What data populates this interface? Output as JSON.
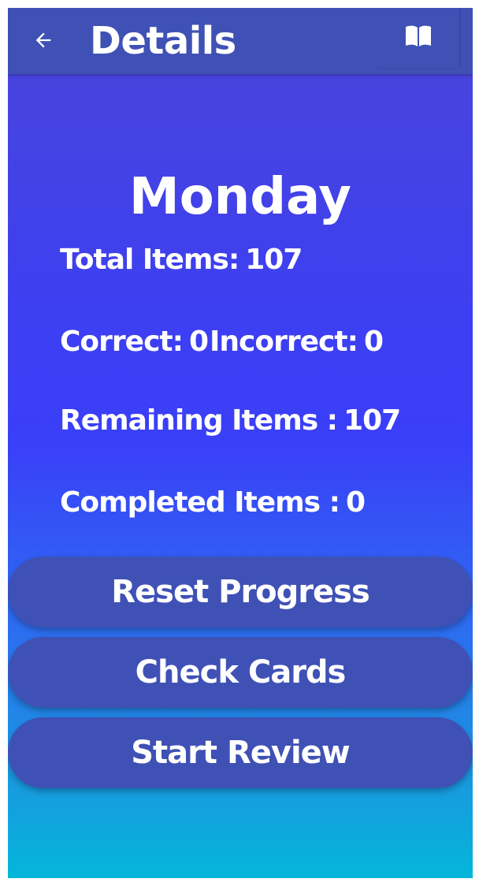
{
  "appbar": {
    "title": "Details",
    "back_icon": "arrow-back-icon",
    "action_icon": "open-book-icon"
  },
  "deck": {
    "name": "Monday"
  },
  "stats": {
    "total_label": "Total Items:",
    "total_value": "107",
    "correct_label": "Correct:",
    "correct_value": "0",
    "incorrect_label": "Incorrect:",
    "incorrect_value": "0",
    "remaining_label": "Remaining Items :",
    "remaining_value": "107",
    "completed_label": "Completed Items :",
    "completed_value": "0"
  },
  "actions": {
    "reset_label": "Reset Progress",
    "check_label": "Check Cards",
    "start_label": "Start Review"
  },
  "colors": {
    "appbar": "#3f51b5",
    "button": "#3f51b5",
    "gradient_top": "#4a46d8",
    "gradient_mid": "#3a3ff8",
    "gradient_bottom": "#04b6da",
    "text": "#ffffff"
  }
}
